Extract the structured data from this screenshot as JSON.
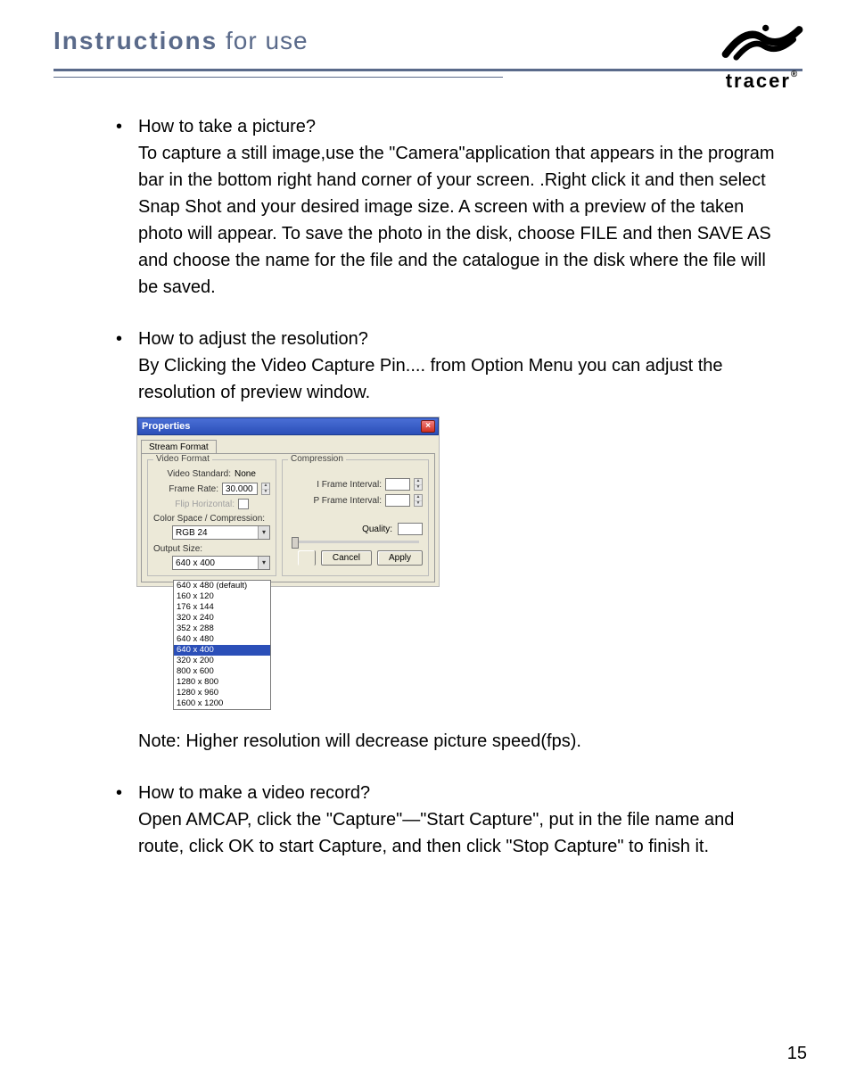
{
  "header": {
    "title_bold": "Instructions",
    "title_rest": " for use",
    "brand": "tracer",
    "brand_reg": "®"
  },
  "sections": [
    {
      "heading": "How to take a picture?",
      "body": "To capture a still image,use the \"Camera\"application that appears in the program bar in the bottom right hand corner of your screen. .Right click it and then select Snap Shot and your desired image size. A screen with a preview of the taken photo will appear. To save the photo in the disk, choose FILE and then SAVE AS and choose the name for the file and the catalogue in the disk where the file will be saved."
    },
    {
      "heading": "How to adjust the resolution?",
      "body": "By Clicking the Video Capture Pin.... from Option Menu you can adjust the resolution of preview window.",
      "note": "Note: Higher resolution will decrease picture speed(fps)."
    },
    {
      "heading": "How to make a video record?",
      "body": "Open AMCAP, click the \"Capture\"—\"Start Capture\", put in the file name and route, click OK to start Capture, and then click \"Stop Capture\" to finish it."
    }
  ],
  "dialog": {
    "title": "Properties",
    "tab": "Stream Format",
    "group_video": "Video Format",
    "group_comp": "Compression",
    "video_standard_label": "Video Standard:",
    "video_standard_value": "None",
    "frame_rate_label": "Frame Rate:",
    "frame_rate_value": "30.000",
    "flip_label": "Flip Horizontal:",
    "colorspace_label": "Color Space / Compression:",
    "colorspace_value": "RGB 24",
    "outputsize_label": "Output Size:",
    "outputsize_value": "640 x 400",
    "i_frame_label": "I Frame Interval:",
    "p_frame_label": "P Frame Interval:",
    "quality_label": "Quality:",
    "btn_cancel": "Cancel",
    "btn_apply": "Apply",
    "size_options": [
      "640 x 480  (default)",
      "160 x 120",
      "176 x 144",
      "320 x 240",
      "352 x 288",
      "640 x 480",
      "640 x 400",
      "320 x 200",
      "800 x 600",
      "1280 x 800",
      "1280 x 960",
      "1600 x 1200"
    ],
    "size_selected_index": 6
  },
  "page_number": "15"
}
